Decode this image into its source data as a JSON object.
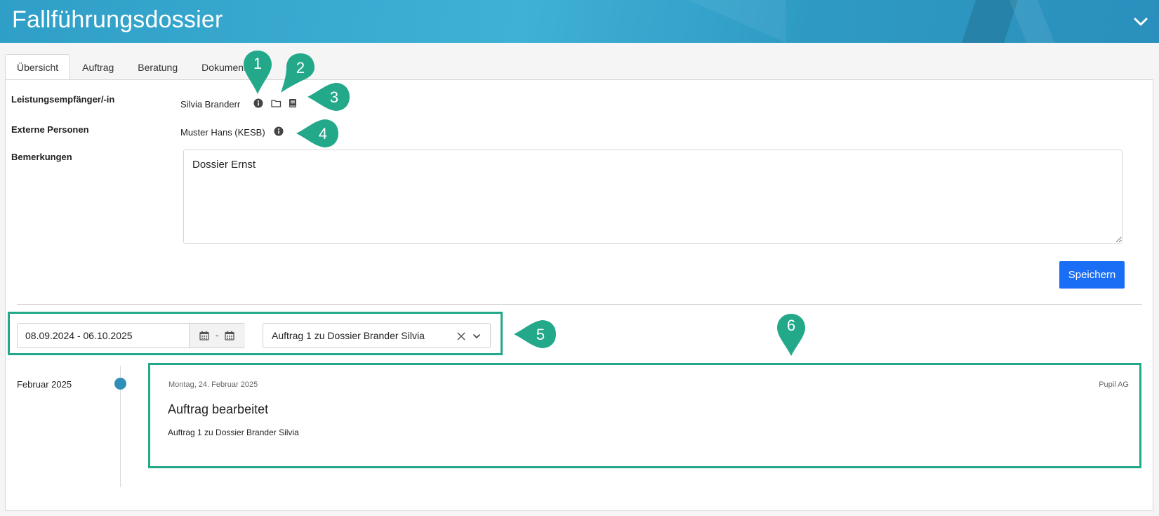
{
  "header": {
    "title": "Fallführungsdossier",
    "collapse_icon": "chevron-down-icon"
  },
  "tabs": [
    {
      "label": "Übersicht",
      "active": true
    },
    {
      "label": "Auftrag",
      "active": false
    },
    {
      "label": "Beratung",
      "active": false
    },
    {
      "label": "Dokumente",
      "active": false
    }
  ],
  "overview": {
    "recipient_label": "Leistungsempfänger/-in",
    "recipient_value": "Silvia Branderr",
    "recipient_icons": [
      "info-icon",
      "folder-icon",
      "book-icon"
    ],
    "external_label": "Externe Personen",
    "external_value": "Muster Hans (KESB)",
    "external_icon": "info-icon",
    "remarks_label": "Bemerkungen",
    "remarks_value": "Dossier Ernst",
    "save_label": "Speichern"
  },
  "filter": {
    "date_range": "08.09.2024 - 06.10.2025",
    "date_separator": "-",
    "assignment": "Auftrag 1 zu Dossier Brander Silvia"
  },
  "timeline": {
    "month": "Februar 2025",
    "entries": [
      {
        "date": "Montag, 24. Februar 2025",
        "author": "Pupil AG",
        "title": "Auftrag bearbeitet",
        "description": "Auftrag 1 zu Dossier Brander Silvia"
      }
    ]
  },
  "annotations": [
    "1",
    "2",
    "3",
    "4",
    "5",
    "6"
  ],
  "colors": {
    "header": "#3aa9d2",
    "primary_button": "#1a6ef5",
    "annotation": "#23a98a",
    "timeline_dot": "#2f8fb8"
  }
}
